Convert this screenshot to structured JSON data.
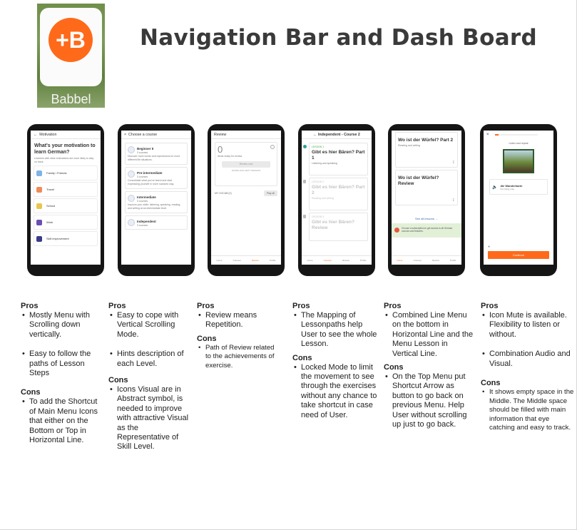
{
  "slide": {
    "title": "Navigation Bar and Dash Board"
  },
  "logo": {
    "symbol": "+B",
    "brand": "Babbel",
    "accent": "#ff6a1a"
  },
  "phones": {
    "motivation": {
      "bar": "Motivation",
      "heading": "What's your motivation to learn German?",
      "subtext": "Learners with clear motivations are more likely to stay on track.",
      "items": [
        "Family / Friends",
        "Travel",
        "School",
        "Work",
        "Skill improvement"
      ]
    },
    "course": {
      "bar": "Choose a course",
      "levels": [
        {
          "name": "Beginner II",
          "meta": "3 courses",
          "desc": "Discover more words and expressions for more different life situations."
        },
        {
          "name": "Pre-intermediate",
          "meta": "3 courses",
          "desc": "Consolidate what you've learnt and start expressing yourself in more nuanced way."
        },
        {
          "name": "Intermediate",
          "meta": "3 courses",
          "desc": "Improve your skills: listening, speaking, reading, and writing at an intermediate level."
        },
        {
          "name": "Independent",
          "meta": "3 courses",
          "desc": ""
        }
      ]
    },
    "review": {
      "bar": "Review",
      "count": "0",
      "caption": "items ready for review",
      "button": "Review now",
      "link": "DOWNLOAD NEXT SESSION",
      "section": "MY VOCAB (0)",
      "play": "Play all",
      "tabs": [
        "Home",
        "Courses",
        "Review",
        "Profile"
      ]
    },
    "lessons": {
      "bar": "Independent - Course 2",
      "items": [
        {
          "tag": "LESSON 1",
          "title": "Gibt es hier Bären? Part 1",
          "sub": "Listening and speaking"
        },
        {
          "tag": "LESSON 2",
          "title": "Gibt es hier Bären? Part 2",
          "sub": "Reading and writing"
        },
        {
          "tag": "LESSON 3",
          "title": "Gibt es hier Bären? Review",
          "sub": ""
        }
      ],
      "tabs": [
        "Home",
        "Courses",
        "Review",
        "Profile"
      ]
    },
    "dashboard": {
      "items": [
        {
          "title": "Wo ist der Würfel? Part 2",
          "sub": "Reading and writing"
        },
        {
          "title": "Wo ist der Würfel? Review",
          "sub": ""
        }
      ],
      "link": "See all lessons",
      "promo": "Choose a subscription to get access to all German courses and features.",
      "tabs": [
        "Home",
        "Courses",
        "Review",
        "Profile"
      ]
    },
    "audio": {
      "prompt": "Listen and repeat",
      "word": "die Wanderkarte",
      "translation": "the hiking map",
      "button": "Continue"
    }
  },
  "columns": [
    {
      "pros_label": "Pros",
      "pros": [
        "Mostly Menu with Scrolling down vertically.",
        "Easy to follow the paths of Lesson Steps"
      ],
      "cons_label": "Cons",
      "cons": [
        "To add the Shortcut of Main Menu Icons that either on the Bottom or Top in Horizontal Line."
      ]
    },
    {
      "pros_label": "Pros",
      "pros": [
        "Easy to cope with Vertical Scrolling Mode.",
        "Hints description of each Level."
      ],
      "cons_label": "Cons",
      "cons": [
        "Icons Visual are in Abstract symbol, is needed to improve with attractive Visual as the Representative of Skill Level."
      ]
    },
    {
      "pros_label": "Pros",
      "pros": [
        "Review means Repetition."
      ],
      "cons_label": "Cons",
      "cons": [
        "Path of Review related to the achievements of exercise."
      ]
    },
    {
      "pros_label": "Pros",
      "pros": [
        "The Mapping of Lessonpaths help User to see the whole Lesson."
      ],
      "cons_label": "Cons",
      "cons": [
        "Locked Mode to limit the movement to see through the exercises without any chance to take shortcut in case need of User."
      ]
    },
    {
      "pros_label": "Pros",
      "pros": [
        "Combined Line Menu on the bottom in Horizontal Line and the Menu Lesson in Vertical Line."
      ],
      "cons_label": "Cons",
      "cons": [
        "On the Top Menu put Shortcut Arrow as button to go back on previous Menu.  Help User without scrolling up just to go back."
      ]
    },
    {
      "pros_label": "Pros",
      "pros": [
        "Icon Mute is available. Flexibility to listen or without.",
        "Combination Audio and Visual."
      ],
      "cons_label": "Cons",
      "cons": [
        "It shows empty space in the Middle. The Middle space should be filled with main information that eye catching and easy to track."
      ]
    }
  ]
}
